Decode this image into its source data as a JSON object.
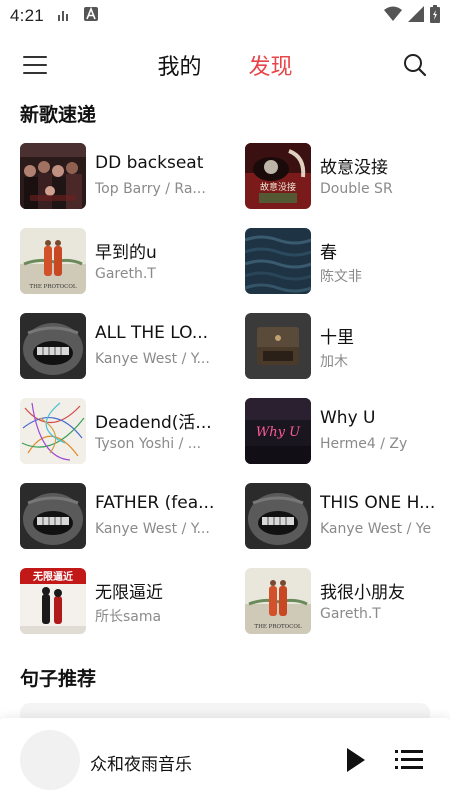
{
  "status_bar": {
    "time": "4:21",
    "left_icons": [
      "signal-bars-small-icon",
      "letter-a-badge-icon"
    ],
    "right_icons": [
      "wifi-icon",
      "cell-signal-icon",
      "battery-icon"
    ]
  },
  "header": {
    "tabs": [
      {
        "label": "我的",
        "active": false
      },
      {
        "label": "发现",
        "active": true
      }
    ],
    "accent_color": "#e8454a"
  },
  "sections": {
    "new_songs_title": "新歌速递",
    "quotes_title": "句子推荐"
  },
  "songs": [
    {
      "title": "DD backseat",
      "artist": "Top Barry / Ra..."
    },
    {
      "title": "故意没接",
      "artist": "Double SR"
    },
    {
      "title": "早到的u",
      "artist": "Gareth.T"
    },
    {
      "title": "春",
      "artist": "陈文非"
    },
    {
      "title": "ALL THE LO...",
      "artist": "Kanye West / Y..."
    },
    {
      "title": "十里",
      "artist": "加木"
    },
    {
      "title": "Deadend(活...",
      "artist": "Tyson Yoshi / ..."
    },
    {
      "title": "Why U",
      "artist": "Herme4 / Zy"
    },
    {
      "title": "FATHER (fea...",
      "artist": "Kanye West / Y..."
    },
    {
      "title": "THIS ONE H...",
      "artist": "Kanye West / Ye"
    },
    {
      "title": "无限逼近",
      "artist": "所长sama"
    },
    {
      "title": "我很小朋友",
      "artist": "Gareth.T"
    }
  ],
  "covers": {
    "protocol_text": "THE PROTOCOL",
    "gugu_text": "故意没接",
    "whyu_text": "Why U",
    "wuxian_text": "无限逼近"
  },
  "player": {
    "title": "众和夜雨音乐"
  }
}
